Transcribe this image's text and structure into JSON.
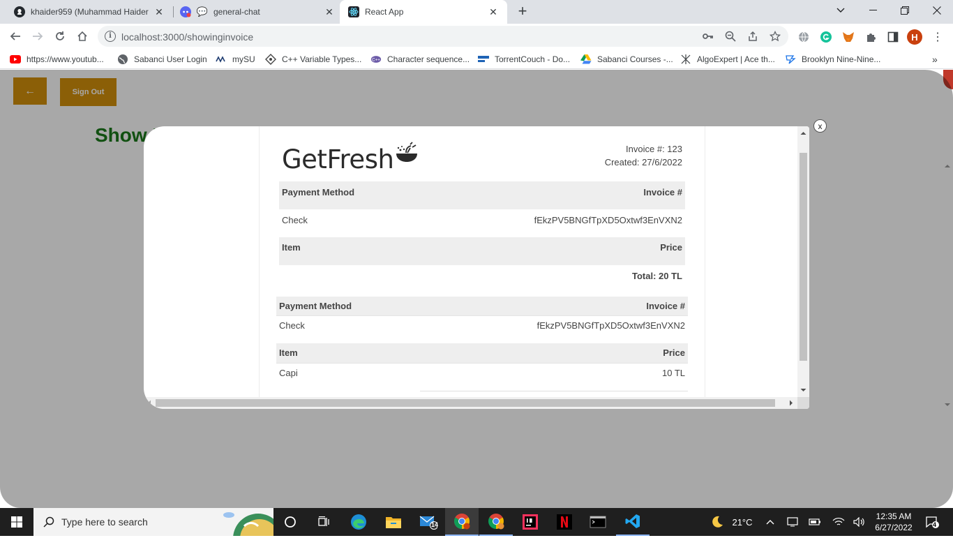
{
  "tabs": [
    {
      "title": "khaider959 (Muhammad Haider",
      "icon": "github-icon"
    },
    {
      "title": "general-chat",
      "icon": "discord-icon"
    },
    {
      "title": "React App",
      "icon": "react-icon",
      "active": true
    }
  ],
  "toolbar": {
    "url": "localhost:3000/showinginvoice"
  },
  "profile_letter": "H",
  "bookmarks": [
    "https://www.youtub...",
    "Sabanci User Login",
    "mySU",
    "C++ Variable Types...",
    "Character sequence...",
    "TorrentCouch - Do...",
    "Sabanci Courses -...",
    "AlgoExpert | Ace th...",
    "Brooklyn Nine-Nine..."
  ],
  "page": {
    "back_label": "←",
    "signout_label": "Sign Out",
    "heading": "Show I",
    "accent_color": "#d4900b",
    "heading_color": "#1a7a1a"
  },
  "modal": {
    "close_label": "x",
    "invoice": {
      "brand": "GetFresh",
      "invoice_no": "Invoice #: 123",
      "created": "Created: 27/6/2022",
      "section1": {
        "h_payment": "Payment Method",
        "h_invoice": "Invoice #",
        "payment": "Check",
        "invoice_id": "fEkzPV5BNGfTpXD5Oxtwf3EnVXN2",
        "h_item": "Item",
        "h_price": "Price",
        "total": "Total: 20 TL"
      },
      "section2": {
        "h_payment": "Payment Method",
        "h_invoice": "Invoice #",
        "payment": "Check",
        "invoice_id": "fEkzPV5BNGfTpXD5Oxtwf3EnVXN2",
        "h_item": "Item",
        "h_price": "Price",
        "item": "Capi",
        "price": "10 TL"
      }
    }
  },
  "taskbar": {
    "search_placeholder": "Type here to search",
    "temperature": "21°C",
    "time": "12:35 AM",
    "date": "6/27/2022",
    "notification_count": "4",
    "mail_badge": "14"
  }
}
